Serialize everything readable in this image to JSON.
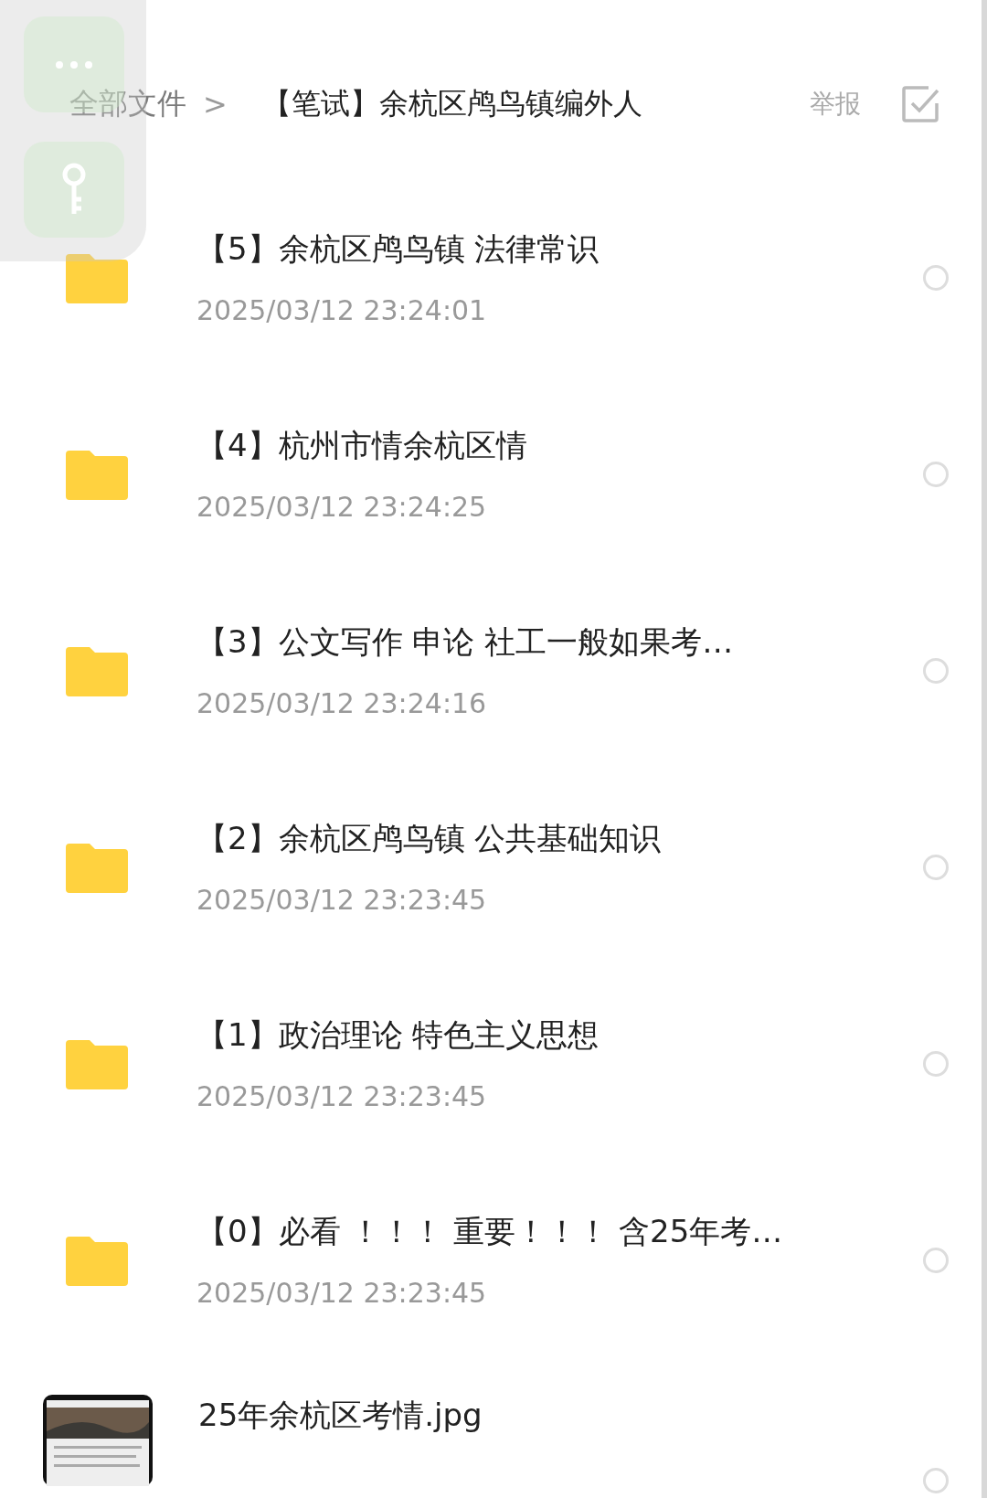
{
  "breadcrumb": {
    "root": "全部文件",
    "separator": ">",
    "current": "【笔试】余杭区鸬鸟镇编外人"
  },
  "actions": {
    "report": "举报"
  },
  "rows": [
    {
      "kind": "folder",
      "name": "【5】余杭区鸬鸟镇  法律常识",
      "date": "2025/03/12  23:24:01",
      "selected": false
    },
    {
      "kind": "folder",
      "name": "【4】杭州市情余杭区情",
      "date": "2025/03/12  23:24:25",
      "selected": false
    },
    {
      "kind": "folder",
      "name": "【3】公文写作  申论  社工一般如果考…",
      "date": "2025/03/12  23:24:16",
      "selected": false
    },
    {
      "kind": "folder",
      "name": "【2】余杭区鸬鸟镇  公共基础知识",
      "date": "2025/03/12  23:23:45",
      "selected": false
    },
    {
      "kind": "folder",
      "name": "【1】政治理论  特色主义思想",
      "date": "2025/03/12  23:23:45",
      "selected": false
    },
    {
      "kind": "folder",
      "name": "【0】必看 ！！！ 重要！！！ 含25年考…",
      "date": "2025/03/12  23:23:45",
      "selected": false
    },
    {
      "name": "25年余杭区考情.jpg",
      "selected": false
    }
  ]
}
